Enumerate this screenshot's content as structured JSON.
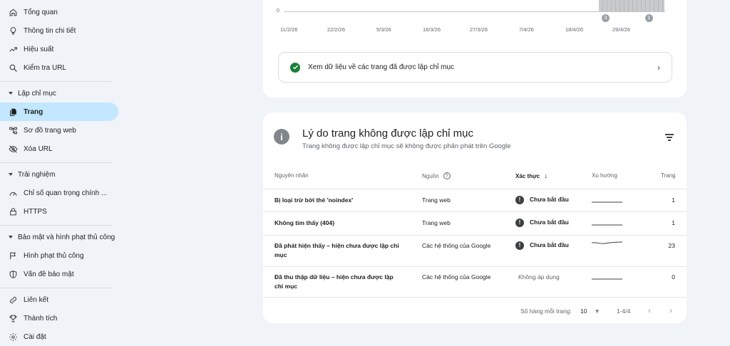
{
  "sidebar": {
    "items": [
      {
        "label": "Tổng quan",
        "icon": "home-icon"
      },
      {
        "label": "Thông tin chi tiết",
        "icon": "lightbulb-icon"
      },
      {
        "label": "Hiệu suất",
        "icon": "trending-up-icon"
      },
      {
        "label": "Kiểm tra URL",
        "icon": "search-icon"
      }
    ],
    "sections": [
      {
        "title": "Lập chỉ mục",
        "items": [
          {
            "label": "Trang",
            "icon": "file-copy-icon",
            "active": true
          },
          {
            "label": "Sơ đồ trang web",
            "icon": "sitemap-icon"
          },
          {
            "label": "Xóa URL",
            "icon": "eye-off-icon"
          }
        ]
      },
      {
        "title": "Trải nghiệm",
        "items": [
          {
            "label": "Chỉ số quan trọng chính ...",
            "icon": "speedometer-icon"
          },
          {
            "label": "HTTPS",
            "icon": "lock-icon"
          }
        ]
      },
      {
        "title": "Bảo mật và hình phạt thủ công",
        "items": [
          {
            "label": "Hình phạt thủ công",
            "icon": "flag-icon"
          },
          {
            "label": "Vấn đề bảo mật",
            "icon": "shield-icon"
          }
        ]
      }
    ],
    "bottom": [
      {
        "label": "Liên kết",
        "icon": "link-icon"
      },
      {
        "label": "Thành tích",
        "icon": "trophy-icon"
      },
      {
        "label": "Cài đặt",
        "icon": "gear-icon"
      }
    ]
  },
  "top_chart": {
    "zero_label": "0",
    "x_ticks": [
      "11/2/26",
      "22/2/26",
      "5/3/26",
      "16/3/26",
      "27/3/26",
      "7/4/26",
      "18/4/26",
      "29/4/26"
    ],
    "markers": [
      "3",
      "1"
    ]
  },
  "view_indexed": {
    "label": "Xem dữ liệu về các trang đã được lập chỉ mục"
  },
  "reasons": {
    "title": "Lý do trang không được lập chỉ mục",
    "subtitle": "Trang không được lập chỉ mục sẽ không được phân phát trên Google",
    "headers": {
      "reason": "Nguyên nhân",
      "source": "Nguồn",
      "validation": "Xác thực",
      "trend": "Xu hướng",
      "pages": "Trang"
    },
    "rows": [
      {
        "reason": "Bị loại trừ bởi thẻ 'noindex'",
        "source": "Trang web",
        "status": "Chưa bắt đầu",
        "pages": "1"
      },
      {
        "reason": "Không tìm thấy (404)",
        "source": "Trang web",
        "status": "Chưa bắt đầu",
        "pages": "1"
      },
      {
        "reason": "Đã phát hiện thấy – hiện chưa được lập chỉ mục",
        "source": "Các hệ thống của Google",
        "status": "Chưa bắt đầu",
        "pages": "23"
      },
      {
        "reason": "Đã thu thập dữ liệu – hiện chưa được lập chỉ mục",
        "source": "Các hệ thống của Google",
        "status": "Không áp dụng",
        "pages": "0"
      }
    ],
    "footer": {
      "rows_per_page_label": "Số hàng mỗi trang:",
      "rows_per_page": "10",
      "range": "1-4/4"
    }
  },
  "colors": {
    "accent": "#c2e7ff",
    "success": "#188038",
    "status_dark": "#3c4043"
  }
}
